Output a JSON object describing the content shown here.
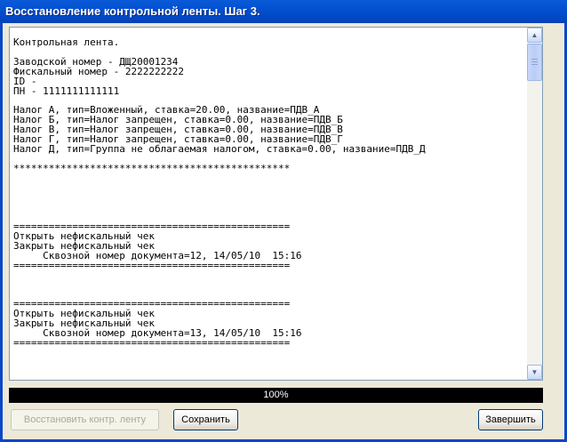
{
  "window": {
    "title": "Восстановление контрольной ленты. Шаг 3."
  },
  "log": {
    "lines": [
      "Контрольная лента.",
      "",
      "Заводской номер - ДЩ20001234",
      "Фискальный номер - 2222222222",
      "ID -",
      "ПН - 1111111111111",
      "",
      "Налог А, тип=Вложенный, ставка=20.00, название=ПДВ_А",
      "Налог Б, тип=Налог запрещен, ставка=0.00, название=ПДВ_Б",
      "Налог В, тип=Налог запрещен, ставка=0.00, название=ПДВ_В",
      "Налог Г, тип=Налог запрещен, ставка=0.00, название=ПДВ_Г",
      "Налог Д, тип=Группа не облагаемая налогом, ставка=0.00, название=ПДВ_Д",
      "",
      "***********************************************",
      "",
      "",
      "",
      "",
      "",
      "===============================================",
      "Открыть нефискальный чек",
      "Закрыть нефискальный чек",
      "     Сквозной номер документа=12, 14/05/10  15:16",
      "===============================================",
      "",
      "",
      "",
      "===============================================",
      "Открыть нефискальный чек",
      "Закрыть нефискальный чек",
      "     Сквозной номер документа=13, 14/05/10  15:16",
      "==============================================="
    ]
  },
  "scrollbar": {
    "up_icon": "arrow-up-icon",
    "down_icon": "arrow-down-icon"
  },
  "progress": {
    "percent": 100,
    "label": "100%"
  },
  "buttons": {
    "restore": "Восстановить контр. ленту",
    "save": "Сохранить",
    "finish": "Завершить"
  },
  "colors": {
    "titlebar": "#0350d0",
    "progress_bg": "#000000",
    "face": "#ece9d8"
  }
}
